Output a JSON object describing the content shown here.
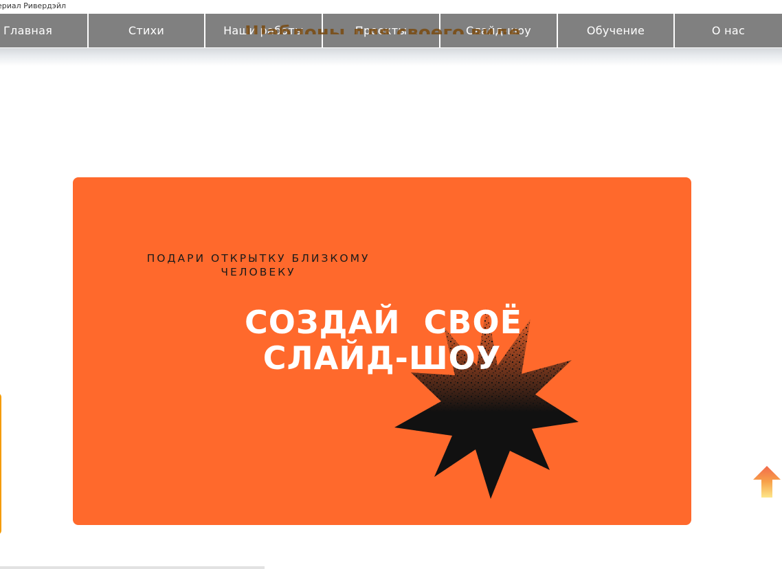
{
  "tab": {
    "title": "ериал Ривердэйл"
  },
  "nav": {
    "items": [
      {
        "label": "Главная"
      },
      {
        "label": "Стихи"
      },
      {
        "label": "Наши работы"
      },
      {
        "label": "Проекты"
      },
      {
        "label": "Слайд-шоу"
      },
      {
        "label": "Обучение"
      },
      {
        "label": "О нас"
      }
    ],
    "overlay_title": "Шаблоны для своего видео"
  },
  "banner": {
    "subtitle_line1": "ПОДАРИ ОТКРЫТКУ БЛИЗКОМУ",
    "subtitle_line2": "ЧЕЛОВЕКУ",
    "headline_line1": "СОЗДАЙ  СВОЁ",
    "headline_line2": "СЛАЙД-ШОУ",
    "background_color": "#ff692c",
    "star_color": "#111111"
  },
  "scroll_top": {
    "icon": "arrow-up-icon"
  }
}
